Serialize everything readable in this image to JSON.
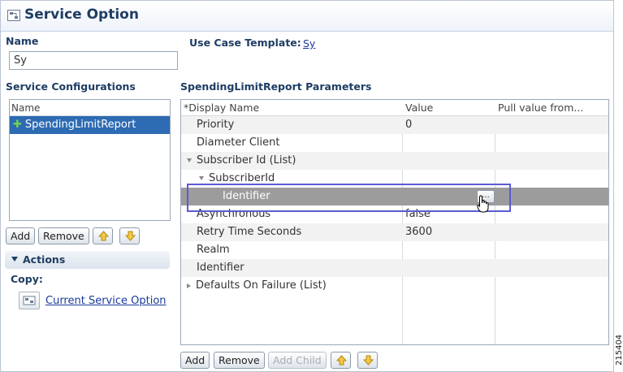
{
  "header": {
    "title": "Service Option",
    "icon": "service-option-icon"
  },
  "name_section": {
    "label": "Name",
    "value": "Sy"
  },
  "use_case": {
    "label": "Use Case Template:",
    "link": "Sy"
  },
  "service_configurations": {
    "label": "Service Configurations",
    "column_header": "Name",
    "items": [
      {
        "label": "SpendingLimitReport",
        "icon": "plus-icon",
        "selected": true
      }
    ],
    "buttons": {
      "add": "Add",
      "remove": "Remove"
    }
  },
  "actions": {
    "title": "Actions",
    "copy_label": "Copy:",
    "copy_link": "Current Service Option"
  },
  "parameters": {
    "title": "SpendingLimitReport Parameters",
    "columns": [
      "*Display Name",
      "Value",
      "Pull value from..."
    ],
    "rows": [
      {
        "name": "Priority",
        "value": "0",
        "pull": "",
        "indent": 0,
        "toggle": ""
      },
      {
        "name": "Diameter Client",
        "value": "",
        "pull": "",
        "indent": 0,
        "toggle": ""
      },
      {
        "name": "Subscriber Id (List)",
        "value": "",
        "pull": "",
        "indent": 0,
        "toggle": "expanded"
      },
      {
        "name": "SubscriberId",
        "value": "",
        "pull": "",
        "indent": 1,
        "toggle": "expanded"
      },
      {
        "name": "Identifier",
        "value": "",
        "pull": "...",
        "indent": 2,
        "toggle": "",
        "selected": true
      },
      {
        "name": "Asynchronous",
        "value": "false",
        "pull": "",
        "indent": 0,
        "toggle": ""
      },
      {
        "name": "Retry Time Seconds",
        "value": "3600",
        "pull": "",
        "indent": 0,
        "toggle": ""
      },
      {
        "name": "Realm",
        "value": "",
        "pull": "",
        "indent": 0,
        "toggle": ""
      },
      {
        "name": "Identifier",
        "value": "",
        "pull": "",
        "indent": 0,
        "toggle": ""
      },
      {
        "name": "Defaults On Failure (List)",
        "value": "",
        "pull": "",
        "indent": 0,
        "toggle": "collapsed"
      }
    ],
    "buttons": {
      "add": "Add",
      "remove": "Remove",
      "add_child": "Add Child"
    }
  },
  "figure_id": "215404"
}
